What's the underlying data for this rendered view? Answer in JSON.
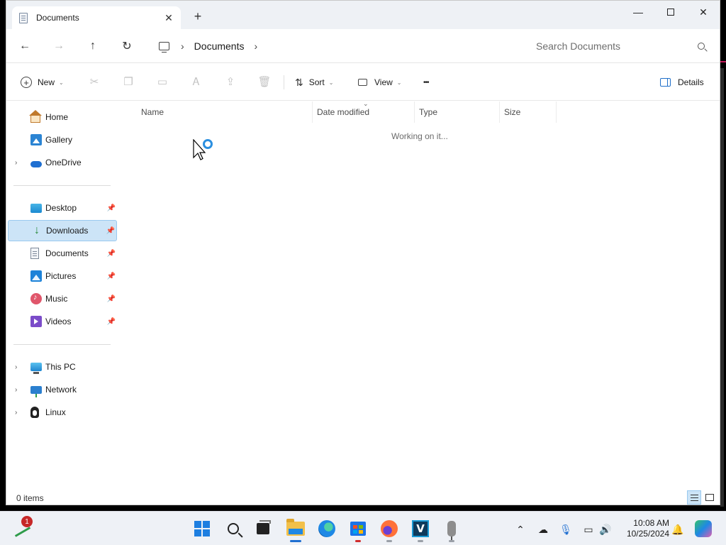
{
  "window": {
    "tab_title": "Documents",
    "new_tab_glyph": "+",
    "close_glyph": "✕"
  },
  "address": {
    "crumbs": [
      "Documents"
    ],
    "search_placeholder": "Search Documents"
  },
  "toolbar": {
    "new_label": "New",
    "sort_label": "Sort",
    "view_label": "View",
    "more_glyph": "•••",
    "details_label": "Details"
  },
  "sidebar": {
    "items": [
      {
        "label": "Home",
        "icon": "home-icon"
      },
      {
        "label": "Gallery",
        "icon": "gallery-icon"
      },
      {
        "label": "OneDrive",
        "icon": "onedrive-icon"
      },
      {
        "label": "Desktop",
        "icon": "desktop-icon",
        "pinned": true
      },
      {
        "label": "Downloads",
        "icon": "downloads-icon",
        "pinned": true,
        "selected": true
      },
      {
        "label": "Documents",
        "icon": "documents-icon",
        "pinned": true
      },
      {
        "label": "Pictures",
        "icon": "pictures-icon",
        "pinned": true
      },
      {
        "label": "Music",
        "icon": "music-icon",
        "pinned": true
      },
      {
        "label": "Videos",
        "icon": "videos-icon",
        "pinned": true
      },
      {
        "label": "This PC",
        "icon": "this-pc-icon"
      },
      {
        "label": "Network",
        "icon": "network-icon"
      },
      {
        "label": "Linux",
        "icon": "linux-icon"
      }
    ]
  },
  "columns": [
    "Name",
    "Date modified",
    "Type",
    "Size"
  ],
  "content": {
    "loading_text": "Working on it..."
  },
  "status": {
    "item_count": "0 items"
  },
  "taskbar": {
    "stocks_badge": "1",
    "time": "10:08 AM",
    "date": "10/25/2024",
    "accent": "#1f6fd1"
  },
  "colors": {
    "selection_bg": "#cce4f7",
    "selection_border": "#99c9ef"
  }
}
